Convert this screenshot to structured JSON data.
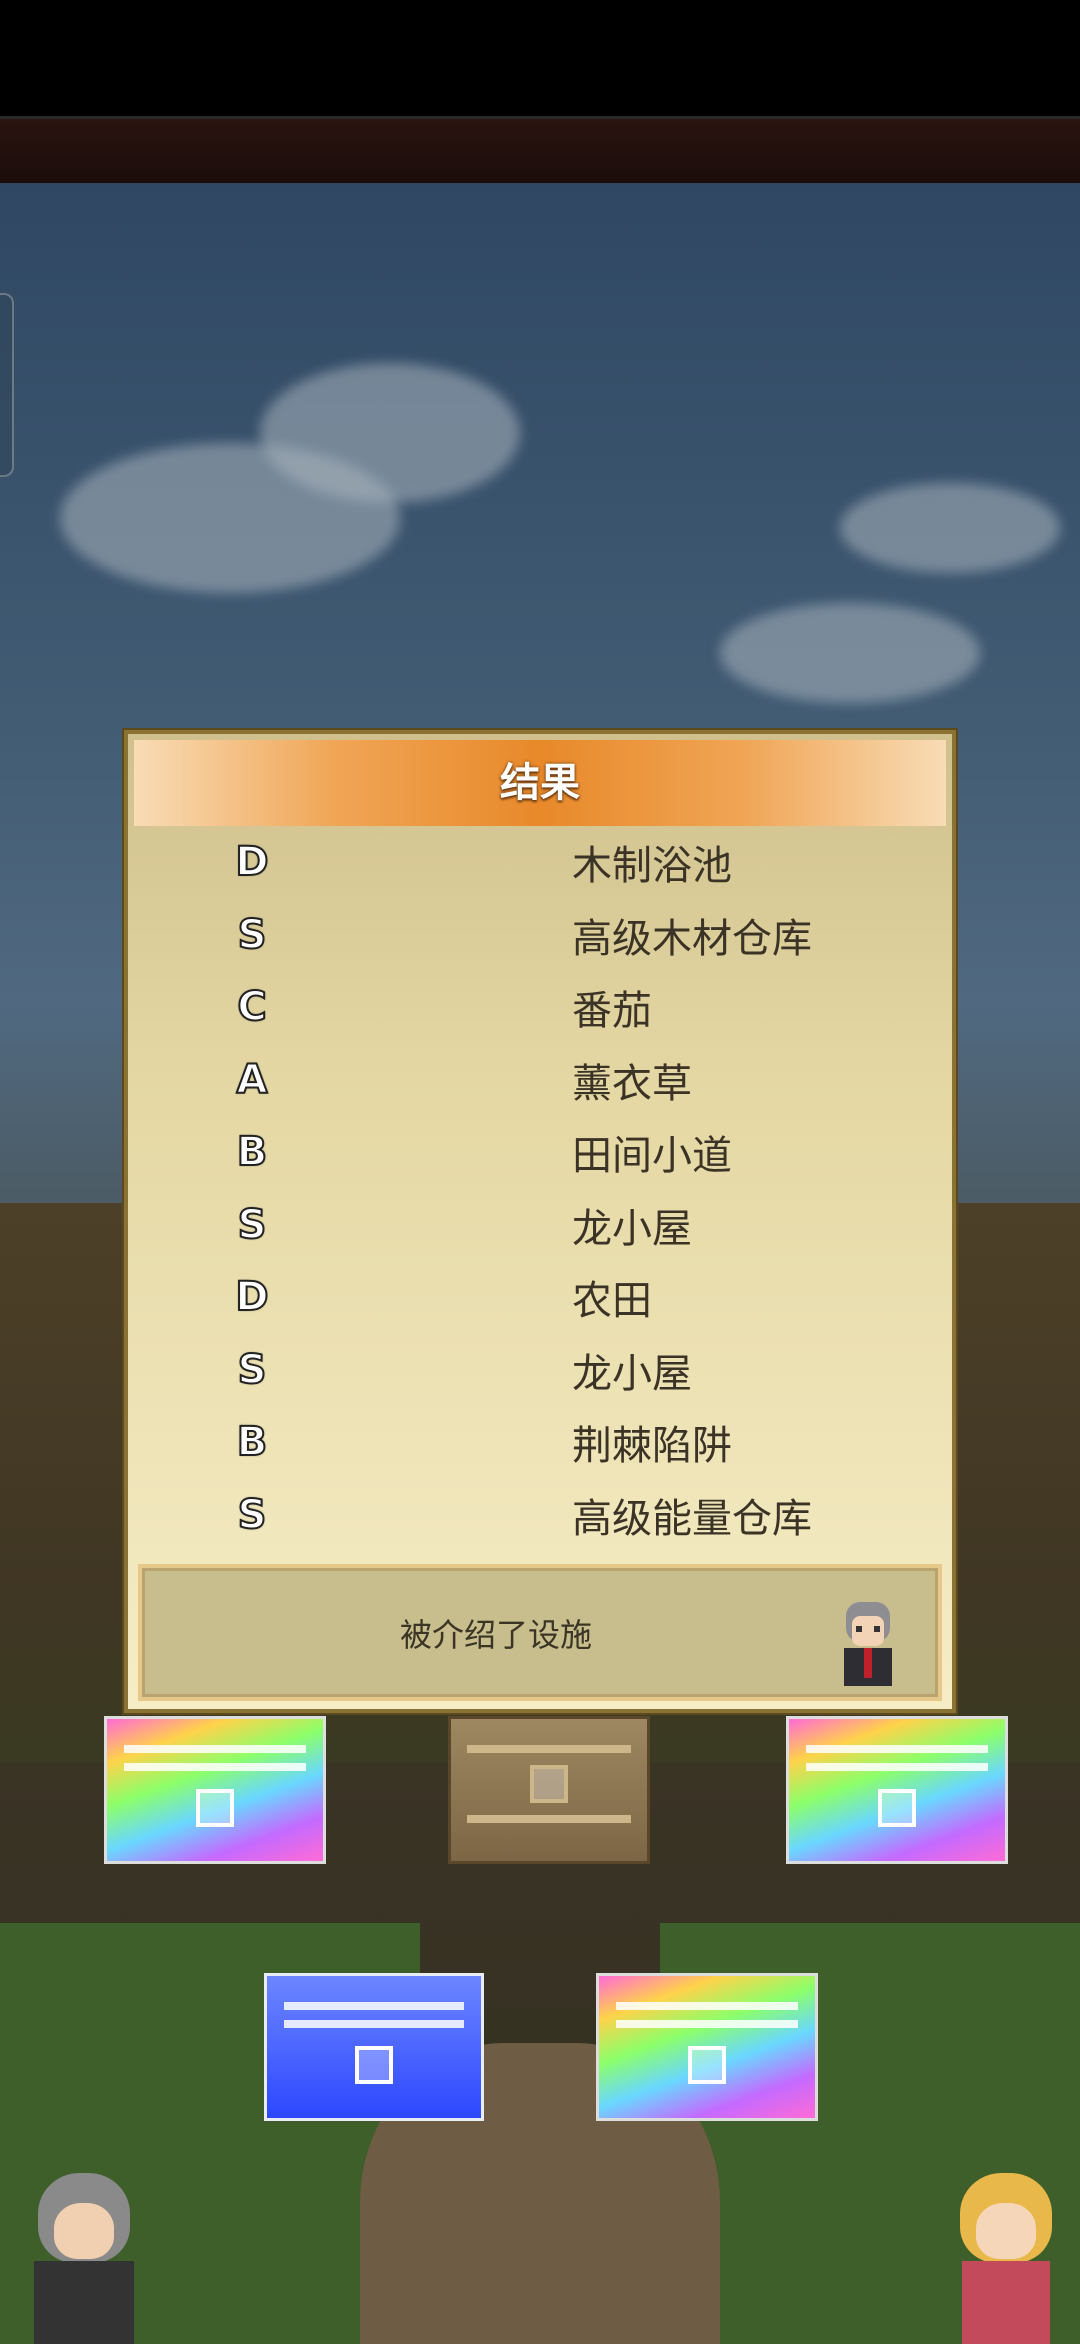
{
  "dialog": {
    "title": "结果",
    "results": [
      {
        "grade": "D",
        "item": "木制浴池"
      },
      {
        "grade": "S",
        "item": "高级木材仓库"
      },
      {
        "grade": "C",
        "item": "番茄"
      },
      {
        "grade": "A",
        "item": "薰衣草"
      },
      {
        "grade": "B",
        "item": "田间小道"
      },
      {
        "grade": "S",
        "item": "龙小屋"
      },
      {
        "grade": "D",
        "item": "农田"
      },
      {
        "grade": "S",
        "item": "龙小屋"
      },
      {
        "grade": "B",
        "item": "荆棘陷阱"
      },
      {
        "grade": "S",
        "item": "高级能量仓库"
      }
    ],
    "message": "被介绍了设施"
  },
  "chests": [
    {
      "type": "rainbow"
    },
    {
      "type": "wood"
    },
    {
      "type": "rainbow"
    },
    {
      "type": "blue"
    },
    {
      "type": "rainbow"
    }
  ],
  "colors": {
    "title_gradient_center": "#e8892a",
    "dialog_border": "#8a7134",
    "sky": "#425c74"
  }
}
